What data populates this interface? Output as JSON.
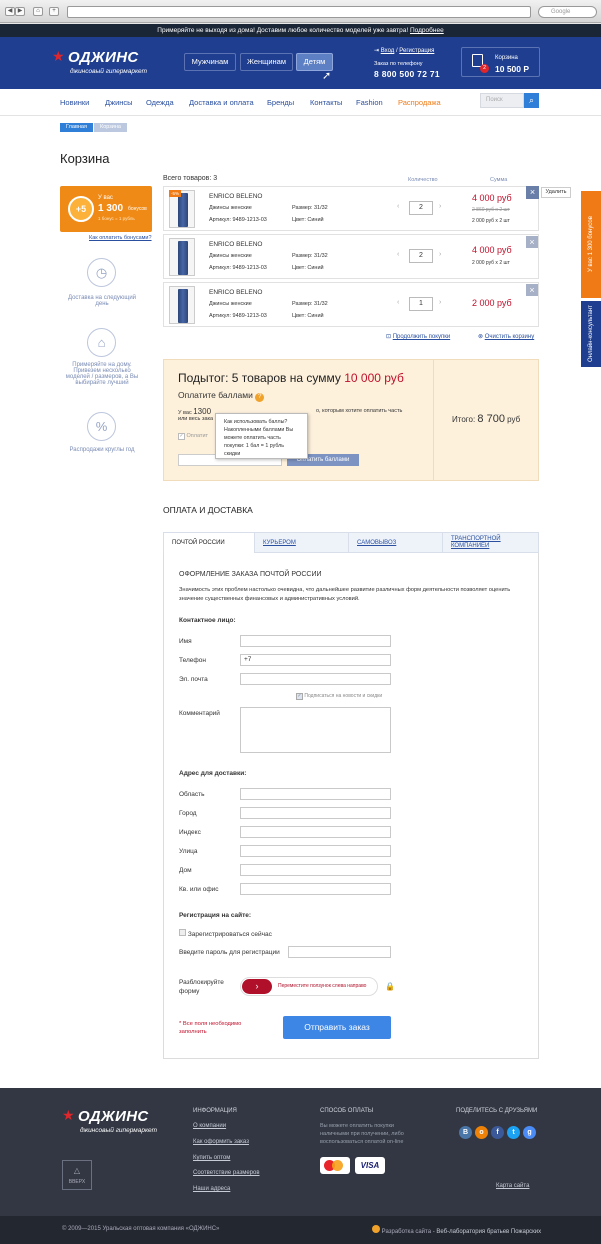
{
  "browser": {
    "search_placeholder": "Google"
  },
  "topbar": {
    "text": "Примеряйте не выходя из дома! Доставим любое количество моделей уже завтра!",
    "link": "Подробнее"
  },
  "header": {
    "logo": "ОДЖИНС",
    "tagline": "джинсовый гипермаркет",
    "gender_tabs": [
      "Мужчинам",
      "Женщинам",
      "Детям"
    ],
    "login": "Вход",
    "register": "Регистрация",
    "phone_label": "Заказ по телефону",
    "phone": "8 800 500 72 71",
    "cart_label": "Корзина",
    "cart_sum": "10 500 Р",
    "cart_count": "2"
  },
  "nav": {
    "items": [
      "Новинки",
      "Джинсы",
      "Одежда",
      "Доставка и оплата",
      "Бренды",
      "Контакты",
      "Fashion",
      "Распродажа"
    ],
    "search_placeholder": "Поиск"
  },
  "breadcrumb": [
    "Главная",
    "Корзина"
  ],
  "page_title": "Корзина",
  "sidebar": {
    "bonus_label": "У вас",
    "bonus_amount": "1 300",
    "bonus_unit": "бонусов",
    "bonus_note": "1 бонус = 1 рубль",
    "bonus_badge": "+5",
    "bonus_link": "Как оплатить бонусами?",
    "features": [
      "Доставка на следующий день",
      "Примеряйте на дому. Привезем несколько моделей / размеров, а Вы выбирайте лучший",
      "Распродажи круглы год"
    ]
  },
  "cart": {
    "total_items": "Всего товаров: 3",
    "col_qty": "Количество",
    "col_sum": "Сумма",
    "delete_tip": "Удалить",
    "items": [
      {
        "brand": "ENRICO BELENO",
        "type": "Джинсы женские",
        "article": "Артикул: 9489-1213-03",
        "size": "Размер: 31/32",
        "color": "Цвет: Синий",
        "qty": "2",
        "price": "4 000 руб",
        "old": "2 860 руб х 2 шт",
        "unit": "2 000 руб х 2 шт",
        "badge": "-5%"
      },
      {
        "brand": "ENRICO BELENO",
        "type": "Джинсы женские",
        "article": "Артикул: 9489-1213-03",
        "size": "Размер: 31/32",
        "color": "Цвет: Синий",
        "qty": "2",
        "price": "4 000 руб",
        "unit": "2 000 руб х 2 шт"
      },
      {
        "brand": "ENRICO BELENO",
        "type": "Джинсы женские",
        "article": "Артикул: 9489-1213-03",
        "size": "Размер: 31/32",
        "color": "Цвет: Синий",
        "qty": "1",
        "price": "2 000 руб"
      }
    ],
    "continue": "Продолжить покупки",
    "clear": "Очистить корзину"
  },
  "totals": {
    "subtotal_prefix": "Подытог: 5 товаров на сумму ",
    "subtotal_amount": "10 000 руб",
    "pay_points": "Оплатите баллами",
    "points_text_a": "У вас ",
    "points_value": "1300",
    "points_text_b": "о, которым хотите оплатить часть",
    "points_text_c": "или весь зака",
    "checkbox": "Оплатит",
    "pay_button": "Оплатить баллами",
    "tooltip": "Как использовать баллы? Накопленными баллами Вы можете оплатить часть покупки: 1 бал = 1 рубль скидки",
    "total_label": "Итого: ",
    "total_amount": "8 700",
    "total_unit": " руб"
  },
  "delivery": {
    "title": "ОПЛАТА И ДОСТАВКА",
    "tabs": [
      "ПОЧТОЙ РОССИИ",
      "КУРЬЕРОМ",
      "САМОВЫВОЗ",
      "ТРАНСПОРТНОЙ КОМПАНИЕЙ"
    ],
    "form_title": "ОФОРМЛЕНИЕ ЗАКАЗА ПОЧТОЙ РОССИИ",
    "intro": "Значимость этих проблем настолько очевидна, что дальнейшее развитие различных форм деятельности позволяет оценить значение существенных финансовых и административных условий.",
    "contact_title": "Контактное лицо:",
    "name": "Имя",
    "phone": "Телефон",
    "phone_value": "+7",
    "email": "Эл. почта",
    "subscribe": "Подписаться на новости и скидки",
    "comment": "Комментарий",
    "address_title": "Адрес для доставки:",
    "address_fields": [
      "Область",
      "Город",
      "Индекс",
      "Улица",
      "Дом",
      "Кв. или офис"
    ],
    "reg_title": "Регистрация на сайте:",
    "reg_now": "Зарегистрироваться сейчас",
    "reg_password": "Введите пароль для регистрации",
    "unlock_label": "Разблокируйте форму",
    "slider_text": "Переместите ползунок слева направо",
    "required_note": "* Все поля необходимо заполнить",
    "submit": "Отправить заказ"
  },
  "footer": {
    "logo": "ОДЖИНС",
    "tagline": "джинсовый гипермаркет",
    "top": "ВВЕРХ",
    "info_title": "ИНФОРМАЦИЯ",
    "info_links": [
      "О компании",
      "Как оформить заказ",
      "Купить оптом",
      "Соответствие размеров",
      "Наши адреса"
    ],
    "pay_title": "СПОСОБ ОПЛАТЫ",
    "pay_text": "Вы можете оплатить покупки наличными при получении, либо воспользоваться оплатой on-line",
    "share_title": "ПОДЕЛИТЕСЬ С ДРУЗЬЯМИ",
    "sitemap": "Карта сайта",
    "copyright": "© 2009—2015 Уральская оптовая компания «ОДЖИНС»",
    "dev_prefix": "Разработка сайта - ",
    "dev_link": "Веб-лаборатория братьев Пожарских"
  },
  "right_tabs": {
    "bonus": "У вас 1 300 бонусов",
    "consult": "Онлайн-консультант"
  }
}
